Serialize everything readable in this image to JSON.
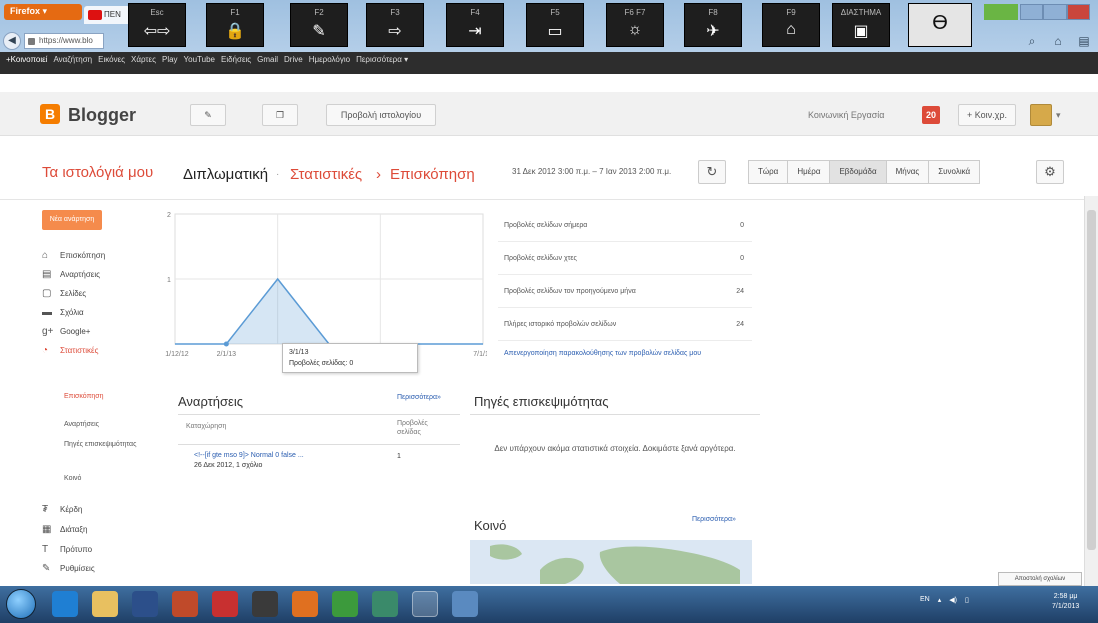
{
  "browser": {
    "tab_orange_label": "Firefox ▾",
    "tab_active_label": "ΠΕΝ",
    "address": "https://www.blo",
    "google_bar": [
      "+Κοινοποιεί",
      "Αναζήτηση",
      "Εικόνες",
      "Χάρτες",
      "Play",
      "YouTube",
      "Ειδήσεις",
      "Gmail",
      "Drive",
      "Ημερολόγιο",
      "Περισσότερα ▾"
    ]
  },
  "fkeys": [
    {
      "key": "Esc",
      "glyph": "⇦⇨"
    },
    {
      "key": "F1",
      "glyph": "🔒"
    },
    {
      "key": "F2",
      "glyph": "✎"
    },
    {
      "key": "F3",
      "glyph": "⇨"
    },
    {
      "key": "F4",
      "glyph": "⇥"
    },
    {
      "key": "F5",
      "glyph": "▭"
    },
    {
      "key": "F6   F7",
      "glyph": "☼"
    },
    {
      "key": "F8",
      "glyph": "✈"
    },
    {
      "key": "F9",
      "glyph": "⌂"
    },
    {
      "key": "ΔΙΑΣΤΗΜΑ",
      "glyph": "▣"
    }
  ],
  "profile_glyph": "ϴ",
  "header": {
    "brand": "Blogger",
    "logo_letter": "B",
    "view_blog_label": "Προβολή ιστολογίου",
    "account_label": "Κοινωνική Εργασία",
    "notification_count": "20",
    "share_label": "+ Κοιν.χρ."
  },
  "title_row": {
    "my_blogs": "Τα ιστολόγιά μου",
    "blog_name": "Διπλωματική",
    "sep1": "·",
    "stats": "Στατιστικές",
    "sep2": "›",
    "overview": "Επισκόπηση",
    "date_range": "31 Δεκ 2012 3:00 π.μ. – 7 Ιαν 2013 2:00 π.μ.",
    "ranges": [
      "Τώρα",
      "Ημέρα",
      "Εβδομάδα",
      "Μήνας",
      "Συνολικά"
    ],
    "selected_range": "Εβδομάδα"
  },
  "sidebar": {
    "new_post": "Νέα ανάρτηση",
    "items": [
      {
        "icon": "home-icon",
        "glyph": "⌂",
        "label": "Επισκόπηση"
      },
      {
        "icon": "posts-icon",
        "glyph": "▤",
        "label": "Αναρτήσεις"
      },
      {
        "icon": "pages-icon",
        "glyph": "▢",
        "label": "Σελίδες"
      },
      {
        "icon": "comments-icon",
        "glyph": "▬",
        "label": "Σχόλια"
      },
      {
        "icon": "google-plus-icon",
        "glyph": "g+",
        "label": "Google+"
      },
      {
        "icon": "stats-icon",
        "glyph": "◔",
        "label": "Στατιστικές"
      }
    ],
    "sub_items": [
      "Επισκόπηση",
      "Αναρτήσεις",
      "Πηγές επισκεψιμότητας",
      "Κοινό"
    ],
    "bottom_items": [
      {
        "icon": "earnings-icon",
        "glyph": "₮",
        "label": "Κέρδη"
      },
      {
        "icon": "layout-icon",
        "glyph": "▦",
        "label": "Διάταξη"
      },
      {
        "icon": "template-icon",
        "glyph": "T",
        "label": "Πρότυπο"
      },
      {
        "icon": "settings-icon",
        "glyph": "✎",
        "label": "Ρυθμίσεις"
      }
    ]
  },
  "chart_data": {
    "type": "line",
    "x": [
      "31/12/12",
      "2/1/13",
      "3/1/13",
      "4/1/13",
      "5/1/13",
      "6/1/13",
      "7/1/13"
    ],
    "x_tick_labels": [
      "31/12/12",
      "2/1/13",
      "7/1/13"
    ],
    "y_ticks": [
      "2",
      "1"
    ],
    "ylim": [
      0,
      2
    ],
    "series": [
      {
        "values": [
          0,
          0,
          1,
          0,
          0,
          0,
          0
        ]
      }
    ],
    "color": "#5b9bd5",
    "grid": true,
    "tooltip": {
      "date": "3/1/13",
      "text": "Προβολές σελίδας: 0"
    }
  },
  "stats": {
    "rows": [
      {
        "label": "Προβολές σελίδων σήμερα",
        "value": "0"
      },
      {
        "label": "Προβολές σελίδων χτες",
        "value": "0"
      },
      {
        "label": "Προβολές σελίδων τον προηγούμενο μήνα",
        "value": "24"
      },
      {
        "label": "Πλήρες ιστορικό προβολών σελίδων",
        "value": "24"
      }
    ],
    "tracking_link": "Απενεργοποίηση παρακολούθησης των προβολών σελίδας μου"
  },
  "posts_panel": {
    "title": "Αναρτήσεις",
    "more": "Περισσότερα»",
    "col_entry": "Καταχώρηση",
    "col_views": "Προβολές σελίδας",
    "row_title": "<!--[if gte mso 9]> Normal 0 false ...",
    "row_meta": "26 Δεκ 2012, 1 σχόλιο",
    "row_views": "1"
  },
  "traffic_panel": {
    "title": "Πηγές επισκεψιμότητας",
    "empty": "Δεν υπάρχουν ακόμα στατιστικά στοιχεία. Δοκιμάστε ξανά αργότερα."
  },
  "audience_panel": {
    "title": "Κοινό",
    "more": "Περισσότερα»"
  },
  "feedback_label": "Αποστολή σχολίων",
  "taskbar": {
    "tray_lang": "EN",
    "time": "2:58 μμ",
    "date": "7/1/2013"
  }
}
